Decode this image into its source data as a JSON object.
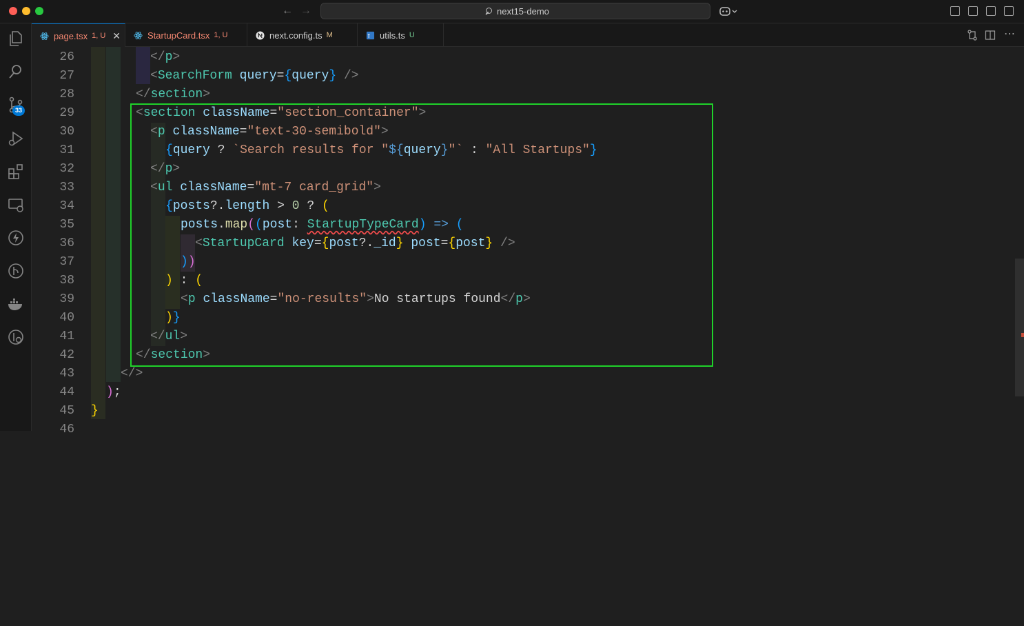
{
  "titlebar": {
    "search_text": "next15-demo"
  },
  "activity": {
    "source_control_badge": "33"
  },
  "tabs": [
    {
      "label": "page.tsx",
      "status": "1, U",
      "active": true
    },
    {
      "label": "StartupCard.tsx",
      "status": "1, U",
      "active": false
    },
    {
      "label": "next.config.ts",
      "status": "M",
      "active": false
    },
    {
      "label": "utils.ts",
      "status": "U",
      "active": false
    }
  ],
  "editor": {
    "lines": [
      {
        "n": "26"
      },
      {
        "n": "27"
      },
      {
        "n": "28"
      },
      {
        "n": "29"
      },
      {
        "n": "30"
      },
      {
        "n": "31"
      },
      {
        "n": "32"
      },
      {
        "n": "33"
      },
      {
        "n": "34"
      },
      {
        "n": "35"
      },
      {
        "n": "36"
      },
      {
        "n": "37"
      },
      {
        "n": "38"
      },
      {
        "n": "39"
      },
      {
        "n": "40"
      },
      {
        "n": "41"
      },
      {
        "n": "42"
      },
      {
        "n": "43"
      },
      {
        "n": "44"
      },
      {
        "n": "45"
      },
      {
        "n": "46"
      }
    ],
    "tokens": {
      "l26": "</p>",
      "l27_tag": "SearchForm",
      "l27_attr": "query",
      "l27_val": "query",
      "l28": "section",
      "l29_tag": "section",
      "l29_attr": "className",
      "l29_str": "\"section_container\"",
      "l30_tag": "p",
      "l30_attr": "className",
      "l30_str": "\"text-30-semibold\"",
      "l31_var": "query",
      "l31_tpl1": "`Search results for \"",
      "l31_tplvar": "query",
      "l31_tpl2": "\"`",
      "l31_str": "\"All Startups\"",
      "l32": "p",
      "l33_tag": "ul",
      "l33_attr": "className",
      "l33_str": "\"mt-7 card_grid\"",
      "l34_var1": "posts",
      "l34_var2": "length",
      "l34_num": "0",
      "l35_var": "posts",
      "l35_fn": "map",
      "l35_param": "post",
      "l35_type": "StartupTypeCard",
      "l36_tag": "StartupCard",
      "l36_attr1": "key",
      "l36_val1": "post",
      "l36_val1b": "_id",
      "l36_attr2": "post",
      "l36_val2": "post",
      "l39_tag": "p",
      "l39_attr": "className",
      "l39_str": "\"no-results\"",
      "l39_text": "No startups found",
      "l41": "ul",
      "l42": "section"
    }
  },
  "colors": {
    "selection_box": "#1fd22a",
    "accent": "#0078d4"
  }
}
